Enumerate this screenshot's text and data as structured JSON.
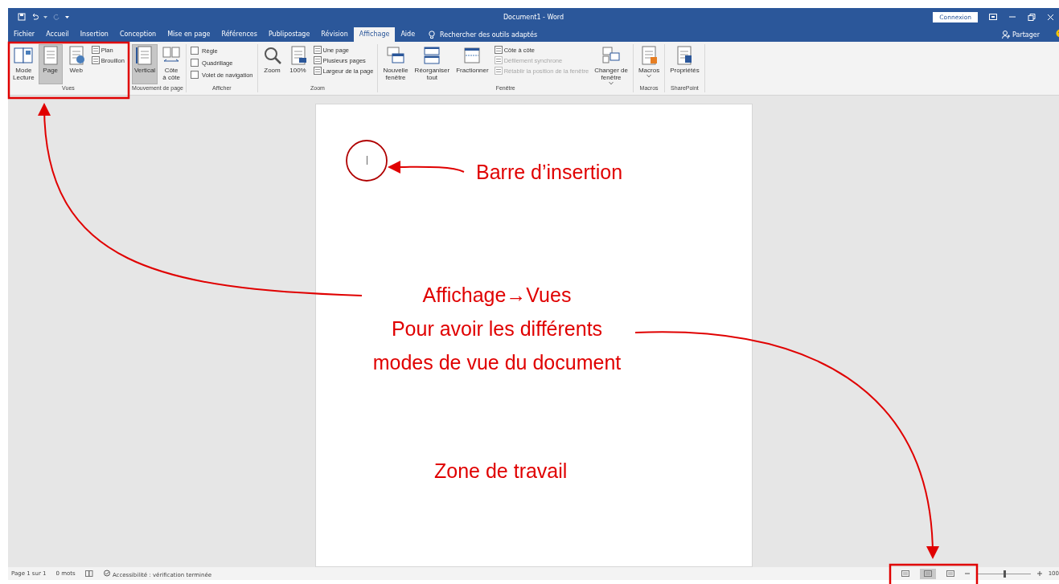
{
  "window": {
    "title": "Document1 - Word",
    "signin_button": "Connexion"
  },
  "tabs": [
    {
      "label": "Fichier",
      "selected": false
    },
    {
      "label": "Accueil",
      "selected": false
    },
    {
      "label": "Insertion",
      "selected": false
    },
    {
      "label": "Conception",
      "selected": false
    },
    {
      "label": "Mise en page",
      "selected": false
    },
    {
      "label": "Références",
      "selected": false
    },
    {
      "label": "Publipostage",
      "selected": false
    },
    {
      "label": "Révision",
      "selected": false
    },
    {
      "label": "Affichage",
      "selected": true
    },
    {
      "label": "Aide",
      "selected": false
    }
  ],
  "tell_me": "Rechercher des outils adaptés",
  "share": "Partager",
  "ribbon": {
    "groups": [
      {
        "label": "Vues",
        "items": [
          {
            "kind": "large",
            "label": "Mode\nLecture",
            "selected": false
          },
          {
            "kind": "large",
            "label": "Page",
            "selected": true
          },
          {
            "kind": "large",
            "label": "Web",
            "selected": false
          },
          {
            "kind": "stack",
            "items": [
              {
                "kind": "small",
                "label": "Plan",
                "disabled": false
              },
              {
                "kind": "small",
                "label": "Brouillon",
                "disabled": false
              }
            ]
          }
        ]
      },
      {
        "label": "Mouvement de page",
        "items": [
          {
            "kind": "large",
            "label": "Vertical",
            "selected": true
          },
          {
            "kind": "large",
            "label": "Côte\nà côte",
            "selected": false
          }
        ]
      },
      {
        "label": "Afficher",
        "items": [
          {
            "kind": "stack",
            "items": [
              {
                "kind": "check",
                "label": "Règle",
                "checked": false
              },
              {
                "kind": "check",
                "label": "Quadrillage",
                "checked": false
              },
              {
                "kind": "check",
                "label": "Volet de navigation",
                "checked": false
              }
            ]
          }
        ]
      },
      {
        "label": "Zoom",
        "items": [
          {
            "kind": "large",
            "label": "Zoom",
            "selected": false
          },
          {
            "kind": "large",
            "label": "100%",
            "selected": false
          },
          {
            "kind": "stack",
            "items": [
              {
                "kind": "small",
                "label": "Une page",
                "disabled": false
              },
              {
                "kind": "small",
                "label": "Plusieurs pages",
                "disabled": false
              },
              {
                "kind": "small",
                "label": "Largeur de la page",
                "disabled": false
              }
            ]
          }
        ]
      },
      {
        "label": "Fenêtre",
        "items": [
          {
            "kind": "large",
            "label": "Nouvelle\nfenêtre",
            "selected": false
          },
          {
            "kind": "large",
            "label": "Réorganiser\ntout",
            "selected": false
          },
          {
            "kind": "large",
            "label": "Fractionner",
            "selected": false
          },
          {
            "kind": "stack",
            "items": [
              {
                "kind": "small",
                "label": "Côte à côte",
                "disabled": false
              },
              {
                "kind": "small",
                "label": "Défilement synchrone",
                "disabled": true
              },
              {
                "kind": "small",
                "label": "Rétablir la position de la fenêtre",
                "disabled": true
              }
            ]
          },
          {
            "kind": "large",
            "label": "Changer de\nfenêtre",
            "selected": false,
            "dropdown": true
          }
        ]
      },
      {
        "label": "Macros",
        "items": [
          {
            "kind": "large",
            "label": "Macros",
            "selected": false,
            "dropdown": true
          }
        ]
      },
      {
        "label": "SharePoint",
        "items": [
          {
            "kind": "large",
            "label": "Propriétés",
            "selected": false
          }
        ]
      }
    ]
  },
  "status_bar": {
    "page": "Page 1 sur 1",
    "words": "0 mots",
    "accessibility": "Accessibilité : vérification terminée",
    "view_buttons": [
      {
        "selected": false
      },
      {
        "selected": true
      },
      {
        "selected": false
      }
    ],
    "zoom": {
      "level": 0.5,
      "reading": "100"
    }
  },
  "annotations": [
    {
      "text": "Barre d’insertion"
    },
    {
      "text": "Affichage→Vues\nPour avoir les différents\nmodes de vue du document"
    },
    {
      "text": "Zone de travail"
    }
  ]
}
